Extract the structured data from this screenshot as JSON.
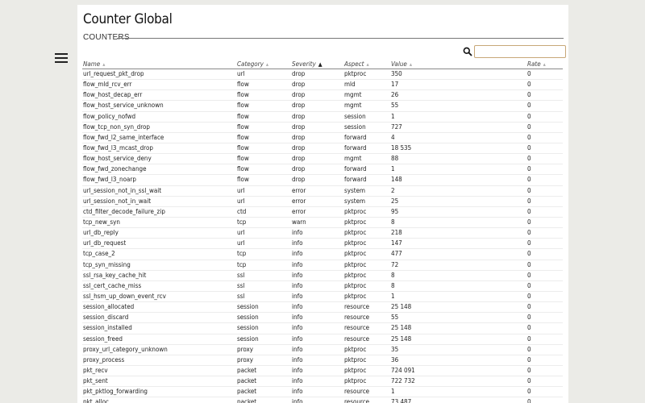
{
  "page": {
    "title": "Counter Global",
    "section": "COUNTERS"
  },
  "search": {
    "placeholder": "",
    "value": ""
  },
  "table": {
    "columns": [
      {
        "key": "name",
        "label": "Name",
        "sort": "none"
      },
      {
        "key": "category",
        "label": "Category",
        "sort": "none"
      },
      {
        "key": "severity",
        "label": "Severity",
        "sort": "asc"
      },
      {
        "key": "aspect",
        "label": "Aspect",
        "sort": "none"
      },
      {
        "key": "value",
        "label": "Value",
        "sort": "none"
      },
      {
        "key": "rate",
        "label": "Rate",
        "sort": "none"
      }
    ],
    "rows": [
      [
        "url_request_pkt_drop",
        "url",
        "drop",
        "pktproc",
        "350",
        "0"
      ],
      [
        "flow_mld_rcv_err",
        "flow",
        "drop",
        "mld",
        "17",
        "0"
      ],
      [
        "flow_host_decap_err",
        "flow",
        "drop",
        "mgmt",
        "26",
        "0"
      ],
      [
        "flow_host_service_unknown",
        "flow",
        "drop",
        "mgmt",
        "55",
        "0"
      ],
      [
        "flow_policy_nofwd",
        "flow",
        "drop",
        "session",
        "1",
        "0"
      ],
      [
        "flow_tcp_non_syn_drop",
        "flow",
        "drop",
        "session",
        "727",
        "0"
      ],
      [
        "flow_fwd_l2_same_interface",
        "flow",
        "drop",
        "forward",
        "4",
        "0"
      ],
      [
        "flow_fwd_l3_mcast_drop",
        "flow",
        "drop",
        "forward",
        "18 535",
        "0"
      ],
      [
        "flow_host_service_deny",
        "flow",
        "drop",
        "mgmt",
        "88",
        "0"
      ],
      [
        "flow_fwd_zonechange",
        "flow",
        "drop",
        "forward",
        "1",
        "0"
      ],
      [
        "flow_fwd_l3_noarp",
        "flow",
        "drop",
        "forward",
        "148",
        "0"
      ],
      [
        "url_session_not_in_ssl_wait",
        "url",
        "error",
        "system",
        "2",
        "0"
      ],
      [
        "url_session_not_in_wait",
        "url",
        "error",
        "system",
        "25",
        "0"
      ],
      [
        "ctd_filter_decode_failure_zip",
        "ctd",
        "error",
        "pktproc",
        "95",
        "0"
      ],
      [
        "tcp_new_syn",
        "tcp",
        "warn",
        "pktproc",
        "8",
        "0"
      ],
      [
        "url_db_reply",
        "url",
        "info",
        "pktproc",
        "218",
        "0"
      ],
      [
        "url_db_request",
        "url",
        "info",
        "pktproc",
        "147",
        "0"
      ],
      [
        "tcp_case_2",
        "tcp",
        "info",
        "pktproc",
        "477",
        "0"
      ],
      [
        "tcp_syn_missing",
        "tcp",
        "info",
        "pktproc",
        "72",
        "0"
      ],
      [
        "ssl_rsa_key_cache_hit",
        "ssl",
        "info",
        "pktproc",
        "8",
        "0"
      ],
      [
        "ssl_cert_cache_miss",
        "ssl",
        "info",
        "pktproc",
        "8",
        "0"
      ],
      [
        "ssl_hsm_up_down_event_rcv",
        "ssl",
        "info",
        "pktproc",
        "1",
        "0"
      ],
      [
        "session_allocated",
        "session",
        "info",
        "resource",
        "25 148",
        "0"
      ],
      [
        "session_discard",
        "session",
        "info",
        "resource",
        "55",
        "0"
      ],
      [
        "session_installed",
        "session",
        "info",
        "resource",
        "25 148",
        "0"
      ],
      [
        "session_freed",
        "session",
        "info",
        "resource",
        "25 148",
        "0"
      ],
      [
        "proxy_url_category_unknown",
        "proxy",
        "info",
        "pktproc",
        "35",
        "0"
      ],
      [
        "proxy_process",
        "proxy",
        "info",
        "pktproc",
        "36",
        "0"
      ],
      [
        "pkt_recv",
        "packet",
        "info",
        "pktproc",
        "724 091",
        "0"
      ],
      [
        "pkt_sent",
        "packet",
        "info",
        "pktproc",
        "722 732",
        "0"
      ],
      [
        "pkt_pktlog_forwarding",
        "packet",
        "info",
        "resource",
        "1",
        "0"
      ],
      [
        "pkt_alloc",
        "packet",
        "info",
        "resource",
        "73 487",
        "0"
      ]
    ]
  }
}
